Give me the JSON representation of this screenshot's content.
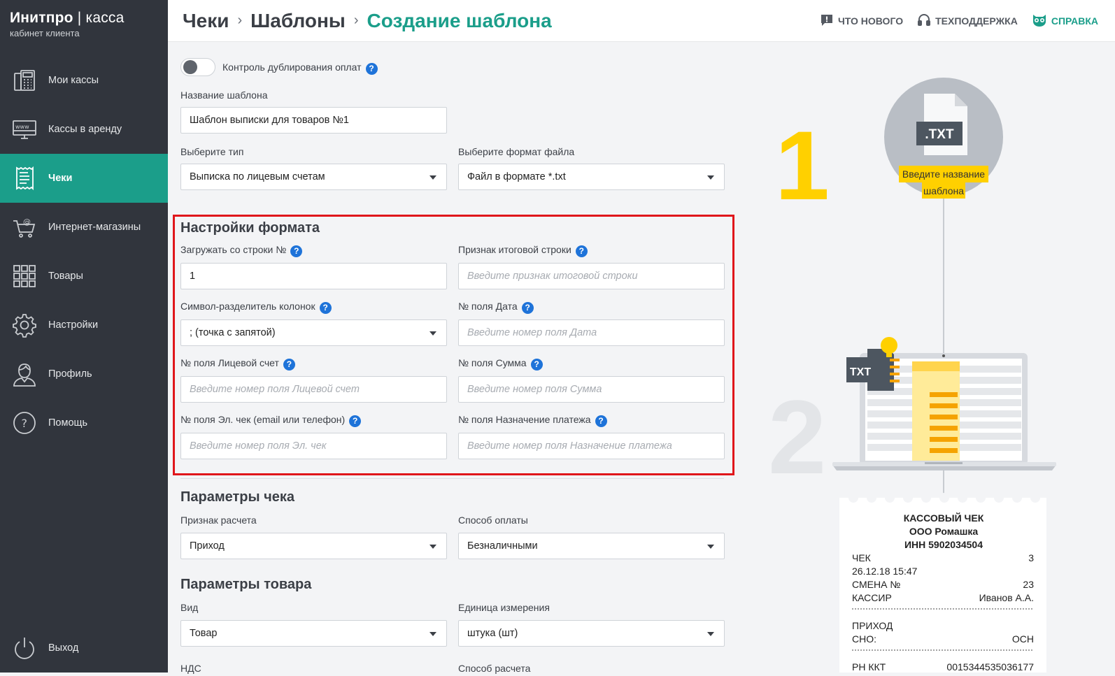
{
  "brand": {
    "name": "Инитпро",
    "divider": "|",
    "product": "касса",
    "subtitle": "кабинет клиента"
  },
  "nav": {
    "items": [
      {
        "label": "Мои кассы",
        "icon": "cash-register-icon"
      },
      {
        "label": "Кассы в аренду",
        "icon": "www-monitor-icon"
      },
      {
        "label": "Чеки",
        "icon": "receipt-icon",
        "active": true
      },
      {
        "label": "Интернет-магазины",
        "icon": "shopping-cart-icon"
      },
      {
        "label": "Товары",
        "icon": "grid-icon"
      },
      {
        "label": "Настройки",
        "icon": "gear-icon"
      },
      {
        "label": "Профиль",
        "icon": "user-icon"
      },
      {
        "label": "Помощь",
        "icon": "help-circle-icon"
      }
    ],
    "exit": {
      "label": "Выход",
      "icon": "power-icon"
    }
  },
  "header": {
    "breadcrumbs": [
      "Чеки",
      "Шаблоны",
      "Создание шаблона"
    ],
    "separator": "›",
    "links": [
      {
        "label": "ЧТО НОВОГО",
        "icon": "chat-alert-icon"
      },
      {
        "label": "ТЕХПОДДЕРЖКА",
        "icon": "headset-icon"
      },
      {
        "label": "СПРАВКА",
        "icon": "owl-icon"
      }
    ]
  },
  "form": {
    "toggle_label": "Контроль дублирования оплат",
    "help": "?",
    "template_name_label": "Название шаблона",
    "template_name_value": "Шаблон выписки для товаров №1",
    "type_label": "Выберите тип",
    "type_value": "Выписка по лицевым счетам",
    "format_label": "Выберите формат файла",
    "format_value": "Файл в формате *.txt",
    "format_settings": {
      "title": "Настройки формата",
      "start_row_label": "Загружать со строки №",
      "start_row_value": "1",
      "total_row_label": "Признак итоговой строки",
      "total_row_placeholder": "Введите признак итоговой строки",
      "separator_label": "Символ-разделитель колонок",
      "separator_value": "; (точка с запятой)",
      "date_field_label": "№ поля Дата",
      "date_field_placeholder": "Введите номер поля Дата",
      "account_field_label": "№ поля Лицевой счет",
      "account_field_placeholder": "Введите номер поля Лицевой счет",
      "sum_field_label": "№ поля Сумма",
      "sum_field_placeholder": "Введите номер поля Сумма",
      "echeck_field_label": "№ поля Эл. чек (email или телефон)",
      "echeck_field_placeholder": "Введите номер поля Эл. чек",
      "purpose_field_label": "№ поля Назначение платежа",
      "purpose_field_placeholder": "Введите номер поля Назначение платежа"
    },
    "check_params": {
      "title": "Параметры чека",
      "calc_sign_label": "Признак расчета",
      "calc_sign_value": "Приход",
      "payment_label": "Способ оплаты",
      "payment_value": "Безналичными"
    },
    "product_params": {
      "title": "Параметры товара",
      "kind_label": "Вид",
      "kind_value": "Товар",
      "unit_label": "Единица измерения",
      "unit_value": "штука (шт)",
      "vat_label": "НДС",
      "calc_method_label": "Способ расчета"
    }
  },
  "illustration": {
    "step1": "1",
    "step2": "2",
    "file_ext": ".TXT",
    "tooltip_line1": "Введите название",
    "tooltip_line2": "шаблона",
    "laptop_badge": "TXT",
    "colors": {
      "accent": "#1b9e8a",
      "yellow": "#ffd000",
      "orange": "#f5a300"
    },
    "receipt": {
      "title": "КАССОВЫЙ ЧЕК",
      "org": "ООО Ромашка",
      "inn": "ИНН 5902034504",
      "rows": [
        {
          "left": "ЧЕК",
          "right": "3"
        },
        {
          "left": "26.12.18 15:47",
          "right": ""
        },
        {
          "left": "СМЕНА №",
          "right": "23"
        },
        {
          "left": "КАССИР",
          "right": "Иванов А.А."
        }
      ],
      "income": "ПРИХОД",
      "sno_label": "СНО:",
      "sno_value": "ОСН",
      "rn_label": "РН ККТ",
      "rn_value": "0015344535036177"
    }
  }
}
